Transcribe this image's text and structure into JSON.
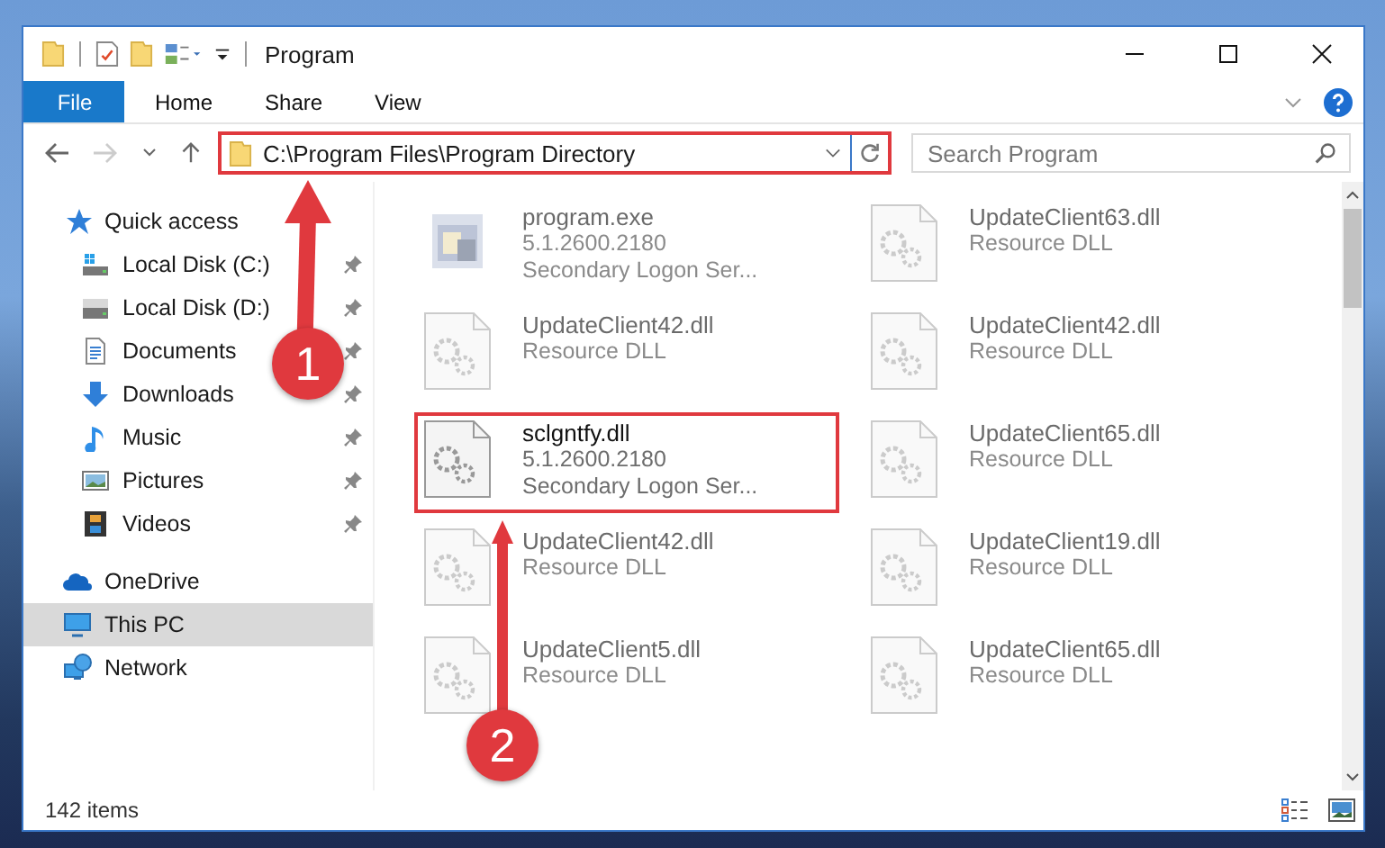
{
  "window": {
    "title": "Program"
  },
  "ribbon_tabs": [
    {
      "label": "File",
      "selected": true
    },
    {
      "label": "Home",
      "selected": false
    },
    {
      "label": "Share",
      "selected": false
    },
    {
      "label": "View",
      "selected": false
    }
  ],
  "address": {
    "path": "C:\\Program Files\\Program Directory",
    "highlighted": true
  },
  "search": {
    "placeholder": "Search Program"
  },
  "nav": [
    {
      "label": "Quick access",
      "kind": "star",
      "pinned": false,
      "selected": false,
      "children": [
        {
          "label": "Local Disk (C:)",
          "kind": "disk-c",
          "pinned": true,
          "selected": false
        },
        {
          "label": "Local Disk (D:)",
          "kind": "disk",
          "pinned": true,
          "selected": false
        },
        {
          "label": "Documents",
          "kind": "documents",
          "pinned": true,
          "selected": false
        },
        {
          "label": "Downloads",
          "kind": "downloads",
          "pinned": true,
          "selected": false
        },
        {
          "label": "Music",
          "kind": "music",
          "pinned": true,
          "selected": false
        },
        {
          "label": "Pictures",
          "kind": "pictures",
          "pinned": true,
          "selected": false
        },
        {
          "label": "Videos",
          "kind": "videos",
          "pinned": true,
          "selected": false
        }
      ]
    },
    {
      "label": "OneDrive",
      "kind": "cloud",
      "pinned": false,
      "selected": false
    },
    {
      "label": "This PC",
      "kind": "pc",
      "pinned": false,
      "selected": true
    },
    {
      "label": "Network",
      "kind": "network",
      "pinned": false,
      "selected": false
    }
  ],
  "files": [
    {
      "name": "program.exe",
      "lines": [
        "5.1.2600.2180",
        "Secondary Logon Ser..."
      ],
      "kind": "exe",
      "blurred": true,
      "highlighted": false
    },
    {
      "name": "UpdateClient63.dll",
      "lines": [
        "Resource DLL"
      ],
      "kind": "dll",
      "blurred": true,
      "highlighted": false
    },
    {
      "name": "UpdateClient42.dll",
      "lines": [
        "Resource DLL"
      ],
      "kind": "dll",
      "blurred": true,
      "highlighted": false
    },
    {
      "name": "UpdateClient42.dll",
      "lines": [
        "Resource DLL"
      ],
      "kind": "dll",
      "blurred": true,
      "highlighted": false
    },
    {
      "name": "sclgntfy.dll",
      "lines": [
        "5.1.2600.2180",
        "Secondary Logon Ser..."
      ],
      "kind": "dll",
      "blurred": false,
      "highlighted": true
    },
    {
      "name": "UpdateClient65.dll",
      "lines": [
        "Resource DLL"
      ],
      "kind": "dll",
      "blurred": true,
      "highlighted": false
    },
    {
      "name": "UpdateClient42.dll",
      "lines": [
        "Resource DLL"
      ],
      "kind": "dll",
      "blurred": true,
      "highlighted": false
    },
    {
      "name": "UpdateClient19.dll",
      "lines": [
        "Resource DLL"
      ],
      "kind": "dll",
      "blurred": true,
      "highlighted": false
    },
    {
      "name": "UpdateClient5.dll",
      "lines": [
        "Resource DLL"
      ],
      "kind": "dll",
      "blurred": true,
      "highlighted": false
    },
    {
      "name": "UpdateClient65.dll",
      "lines": [
        "Resource DLL"
      ],
      "kind": "dll",
      "blurred": true,
      "highlighted": false
    }
  ],
  "status_bar": {
    "count": "142 items"
  },
  "annotations": [
    {
      "label": "1"
    },
    {
      "label": "2"
    }
  ]
}
